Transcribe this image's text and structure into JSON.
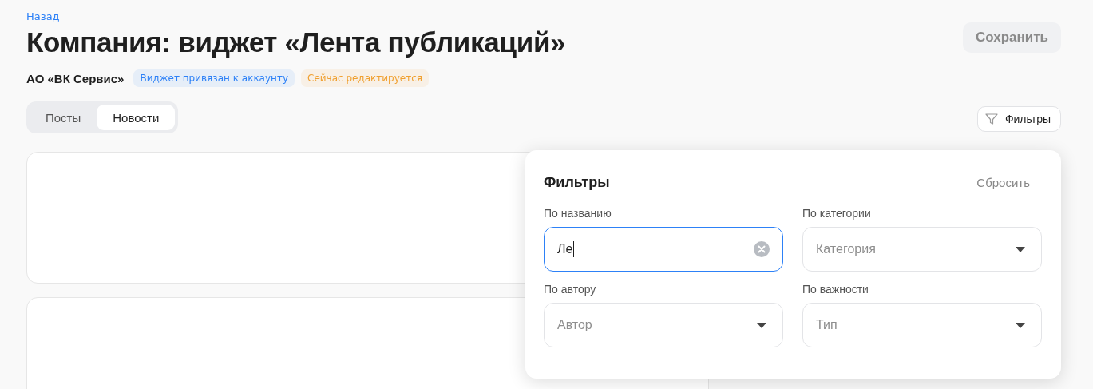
{
  "back_link": "Назад",
  "title": "Компания: виджет «Лента публикаций»",
  "save_button": {
    "label": "Сохранить",
    "disabled": true
  },
  "company": "АО «ВК Сервис»",
  "badges": [
    {
      "label": "Виджет привязан к аккаунту",
      "color": "#2d81f7"
    },
    {
      "label": "Сейчас редактируется",
      "color": "#f0a030"
    }
  ],
  "tabs": [
    {
      "label": "Посты",
      "selected": false
    },
    {
      "label": "Новости",
      "selected": true
    }
  ],
  "filter_button": "Фильтры",
  "filters": {
    "title": "Фильтры",
    "reset": "Сбросить",
    "fields": [
      {
        "label": "По названию",
        "kind": "text",
        "value": "Ле",
        "focused": true
      },
      {
        "label": "По категории",
        "kind": "select",
        "placeholder": "Категория",
        "focused": false
      },
      {
        "label": "По автору",
        "kind": "select",
        "placeholder": "Автор",
        "focused": false
      },
      {
        "label": "По важности",
        "kind": "select",
        "placeholder": "Тип",
        "focused": false
      }
    ]
  }
}
